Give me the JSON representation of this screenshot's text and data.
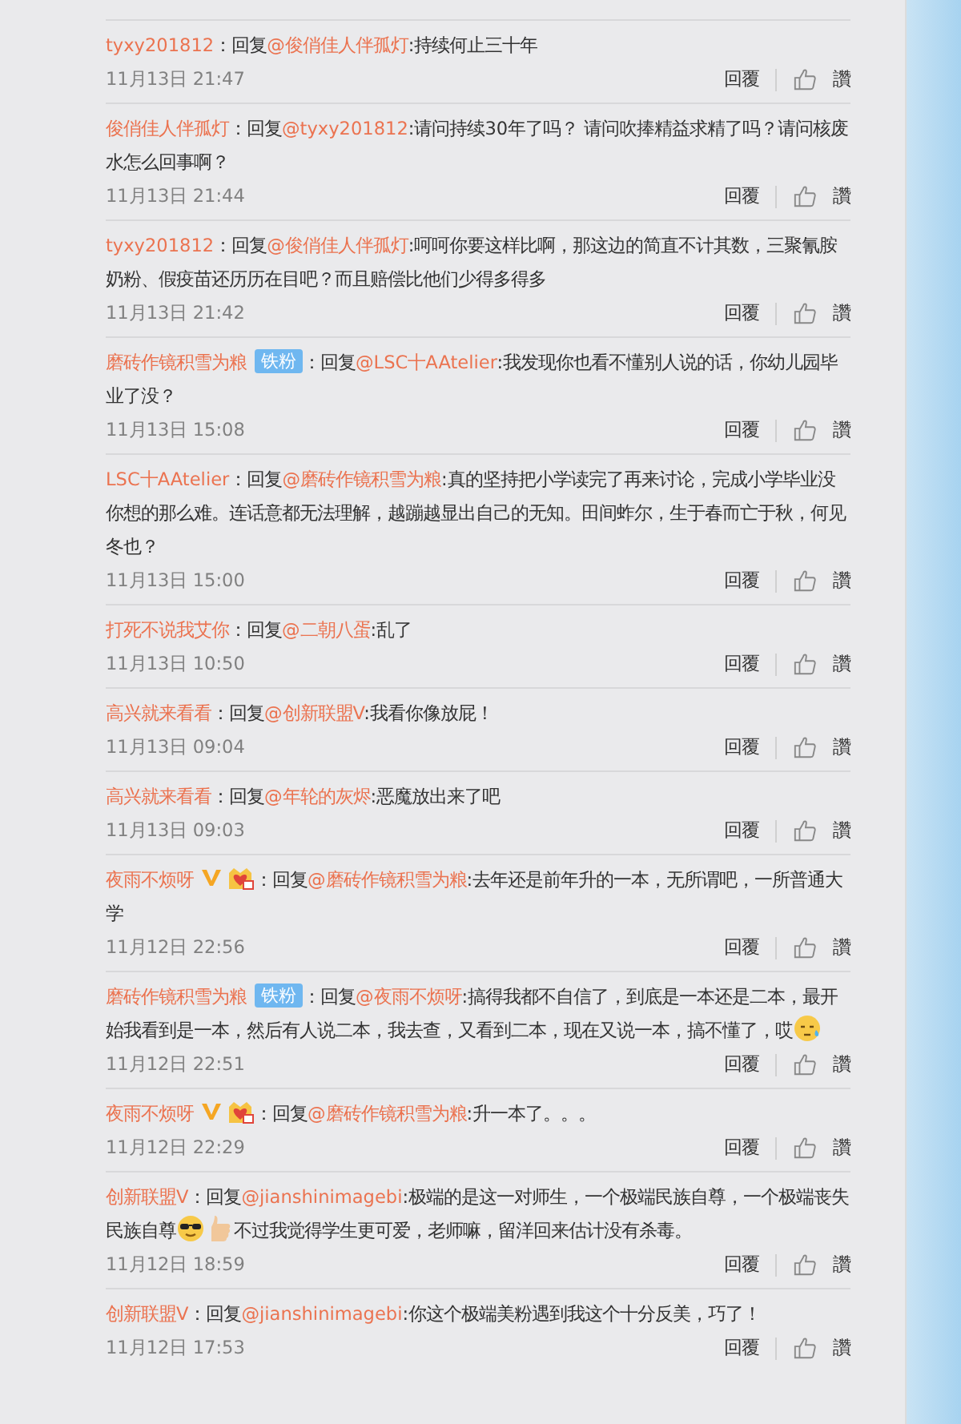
{
  "comments": [
    {
      "user": "tyxy201812",
      "segments": [
        {
          "kind": "text",
          "text": "：回复"
        },
        {
          "kind": "mention",
          "text": "@俊俏佳人伴孤灯"
        },
        {
          "kind": "text",
          "text": ":持续何止三十年"
        }
      ],
      "time": "11月13日 21:47",
      "reply": "回覆",
      "like": "讚"
    },
    {
      "user": "俊俏佳人伴孤灯",
      "segments": [
        {
          "kind": "text",
          "text": "：回复"
        },
        {
          "kind": "mention",
          "text": "@tyxy201812"
        },
        {
          "kind": "text",
          "text": ":请问持续30年了吗？ 请问吹捧精益求精了吗？请问核废水怎么回事啊？"
        }
      ],
      "time": "11月13日 21:44",
      "reply": "回覆",
      "like": "讚"
    },
    {
      "user": "tyxy201812",
      "segments": [
        {
          "kind": "text",
          "text": "：回复"
        },
        {
          "kind": "mention",
          "text": "@俊俏佳人伴孤灯"
        },
        {
          "kind": "text",
          "text": ":呵呵你要这样比啊，那这边的简直不计其数，三聚氰胺奶粉、假疫苗还历历在目吧？而且赔偿比他们少得多得多"
        }
      ],
      "time": "11月13日 21:42",
      "reply": "回覆",
      "like": "讚"
    },
    {
      "user": "磨砖作镜积雪为粮",
      "badges": [
        {
          "kind": "fan",
          "text": "铁粉"
        }
      ],
      "segments": [
        {
          "kind": "text",
          "text": "：回复"
        },
        {
          "kind": "mention",
          "text": "@LSC十AAtelier"
        },
        {
          "kind": "text",
          "text": ":我发现你也看不懂别人说的话，你幼儿园毕业了没？"
        }
      ],
      "time": "11月13日 15:08",
      "reply": "回覆",
      "like": "讚"
    },
    {
      "user": "LSC十AAtelier",
      "segments": [
        {
          "kind": "text",
          "text": "：回复"
        },
        {
          "kind": "mention",
          "text": "@磨砖作镜积雪为粮"
        },
        {
          "kind": "text",
          "text": ":真的坚持把小学读完了再来讨论，完成小学毕业没你想的那么难。连话意都无法理解，越蹦越显出自己的无知。田间蚱尔，生于春而亡于秋，何见冬也？"
        }
      ],
      "time": "11月13日 15:00",
      "reply": "回覆",
      "like": "讚"
    },
    {
      "user": "打死不说我艾你",
      "segments": [
        {
          "kind": "text",
          "text": "：回复"
        },
        {
          "kind": "mention",
          "text": "@二朝八蛋"
        },
        {
          "kind": "text",
          "text": ":乱了"
        }
      ],
      "time": "11月13日 10:50",
      "reply": "回覆",
      "like": "讚"
    },
    {
      "user": "高兴就来看看",
      "segments": [
        {
          "kind": "text",
          "text": "：回复"
        },
        {
          "kind": "mention",
          "text": "@创新联盟V"
        },
        {
          "kind": "text",
          "text": ":我看你像放屁！"
        }
      ],
      "time": "11月13日 09:04",
      "reply": "回覆",
      "like": "讚"
    },
    {
      "user": "高兴就来看看",
      "segments": [
        {
          "kind": "text",
          "text": "：回复"
        },
        {
          "kind": "mention",
          "text": "@年轮的灰烬"
        },
        {
          "kind": "text",
          "text": ":恶魔放出来了吧"
        }
      ],
      "time": "11月13日 09:03",
      "reply": "回覆",
      "like": "讚"
    },
    {
      "user": "夜雨不烦呀",
      "badges": [
        {
          "kind": "verified"
        },
        {
          "kind": "vip"
        }
      ],
      "segments": [
        {
          "kind": "text",
          "text": "：回复"
        },
        {
          "kind": "mention",
          "text": "@磨砖作镜积雪为粮"
        },
        {
          "kind": "text",
          "text": ":去年还是前年升的一本，无所谓吧，一所普通大学"
        }
      ],
      "time": "11月12日 22:56",
      "reply": "回覆",
      "like": "讚"
    },
    {
      "user": "磨砖作镜积雪为粮",
      "badges": [
        {
          "kind": "fan",
          "text": "铁粉"
        }
      ],
      "segments": [
        {
          "kind": "text",
          "text": "：回复"
        },
        {
          "kind": "mention",
          "text": "@夜雨不烦呀"
        },
        {
          "kind": "text",
          "text": ":搞得我都不自信了，到底是一本还是二本，最开始我看到是一本，然后有人说二本，我去查，又看到二本，现在又说一本，搞不懂了，哎"
        },
        {
          "kind": "sweat"
        }
      ],
      "time": "11月12日 22:51",
      "reply": "回覆",
      "like": "讚"
    },
    {
      "user": "夜雨不烦呀",
      "badges": [
        {
          "kind": "verified"
        },
        {
          "kind": "vip"
        }
      ],
      "segments": [
        {
          "kind": "text",
          "text": "：回复"
        },
        {
          "kind": "mention",
          "text": "@磨砖作镜积雪为粮"
        },
        {
          "kind": "text",
          "text": ":升一本了。。。"
        }
      ],
      "time": "11月12日 22:29",
      "reply": "回覆",
      "like": "讚"
    },
    {
      "user": "创新联盟V",
      "segments": [
        {
          "kind": "text",
          "text": "：回复"
        },
        {
          "kind": "mention",
          "text": "@jianshinimagebi"
        },
        {
          "kind": "text",
          "text": ":极端的是这一对师生，一个极端民族自尊，一个极端丧失民族自尊"
        },
        {
          "kind": "cool"
        },
        {
          "kind": "thumb"
        },
        {
          "kind": "text",
          "text": "不过我觉得学生更可爱，老师嘛，留洋回来估计没有杀毒。"
        }
      ],
      "time": "11月12日 18:59",
      "reply": "回覆",
      "like": "讚"
    },
    {
      "user": "创新联盟V",
      "segments": [
        {
          "kind": "text",
          "text": "：回复"
        },
        {
          "kind": "mention",
          "text": "@jianshinimagebi"
        },
        {
          "kind": "text",
          "text": ":你这个极端美粉遇到我这个十分反美，巧了！"
        }
      ],
      "time": "11月12日 17:53",
      "reply": "回覆",
      "like": "讚"
    }
  ]
}
